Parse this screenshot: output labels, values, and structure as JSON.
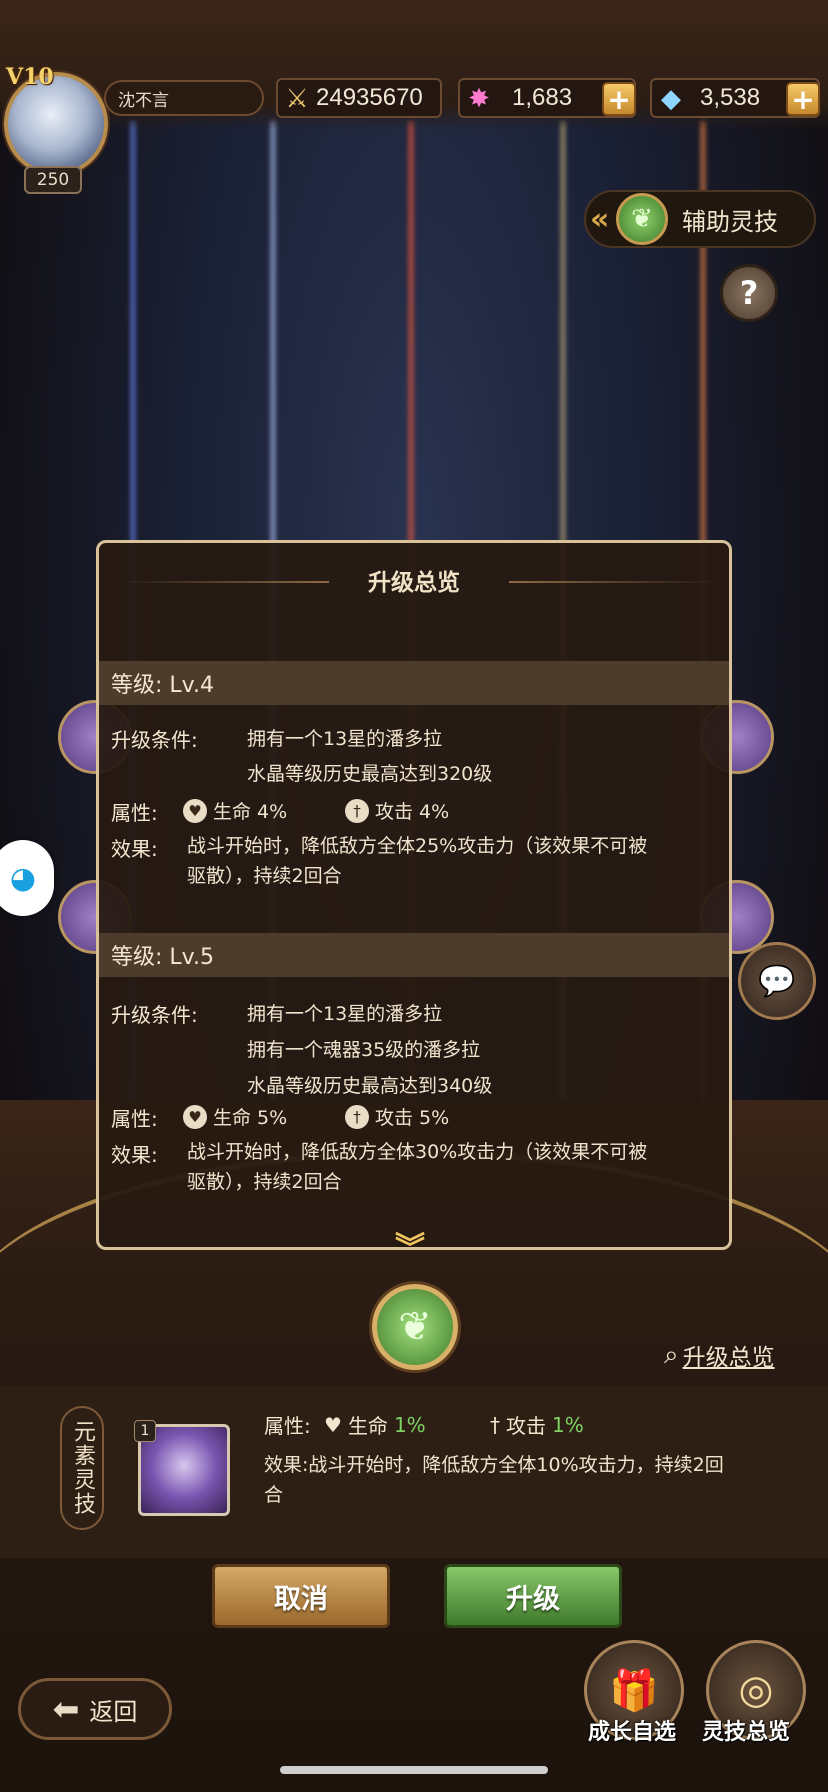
{
  "player": {
    "vip": "V10",
    "level": "250",
    "name": "沈不言",
    "power": "24935670",
    "crystal": "1,683",
    "diamond": "3,538"
  },
  "aux_tab": {
    "label": "辅助灵技"
  },
  "help": {
    "symbol": "?"
  },
  "popup": {
    "title": "升级总览",
    "levels": [
      {
        "level_label": "等级: Lv.4",
        "conditions_key": "升级条件:",
        "conditions": [
          "拥有一个13星的潘多拉",
          "水晶等级历史最高达到320级"
        ],
        "attr_key": "属性:",
        "attr_hp": "生命 4%",
        "attr_atk": "攻击 4%",
        "effect_key": "效果:",
        "effect": "战斗开始时，降低敌方全体25%攻击力（该效果不可被驱散），持续2回合"
      },
      {
        "level_label": "等级: Lv.5",
        "conditions_key": "升级条件:",
        "conditions": [
          "拥有一个13星的潘多拉",
          "拥有一个魂器35级的潘多拉",
          "水晶等级历史最高达到340级"
        ],
        "attr_key": "属性:",
        "attr_hp": "生命 5%",
        "attr_atk": "攻击 5%",
        "effect_key": "效果:",
        "effect": "战斗开始时，降低敌方全体30%攻击力（该效果不可被驱散），持续2回合"
      }
    ]
  },
  "overview_link": "升级总览",
  "current": {
    "category": "元素灵技",
    "count": "1",
    "attr_key": "属性:",
    "hp_label": "生命",
    "hp_value": "1%",
    "atk_label": "攻击",
    "atk_value": "1%",
    "effect": "效果:战斗开始时，降低敌方全体10%攻击力，持续2回合"
  },
  "buttons": {
    "cancel": "取消",
    "upgrade": "升级",
    "back": "返回"
  },
  "corner": {
    "growth": "成长自选",
    "overview": "灵技总览"
  },
  "icons": {
    "power": "crossed-swords-icon",
    "crystal": "crystal-burst-icon",
    "diamond": "diamond-icon",
    "leaf": "leaf-icon",
    "heart": "heart-icon",
    "sword": "sword-icon"
  },
  "colors": {
    "accent_gold": "#d9a84d",
    "green_value": "#7fd263",
    "panel": "#261911"
  }
}
